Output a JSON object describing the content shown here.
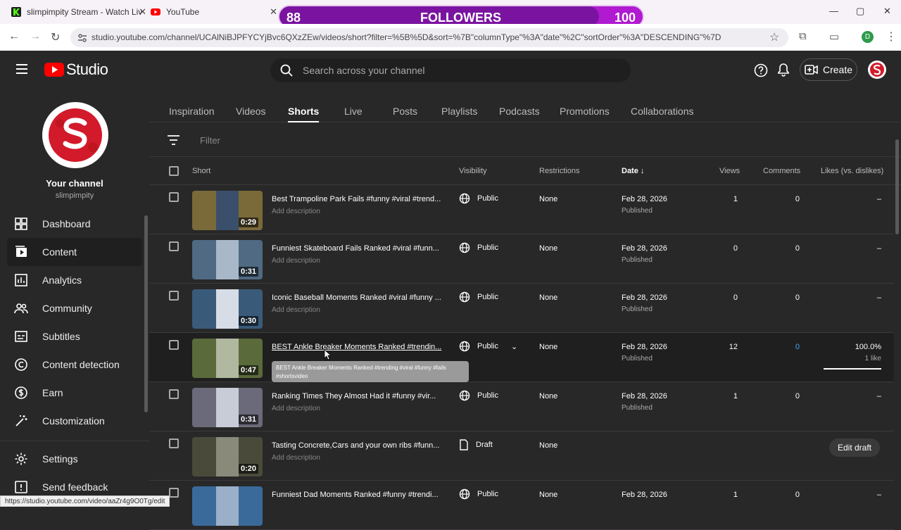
{
  "browser": {
    "tabs": [
      {
        "title": "slimpimpity Stream - Watch Liv"
      },
      {
        "title": "YouTube"
      }
    ],
    "url": "studio.youtube.com/channel/UCAlNiBJPFYCYjBvc6QXzZEw/videos/short?filter=%5B%5D&sort=%7B\"columnType\"%3A\"date\"%2C\"sortOrder\"%3A\"DESCENDING\"%7D",
    "profile_letter": "D",
    "status_url": "https://studio.youtube.com/video/aaZr4g9O0Tg/edit"
  },
  "overlay": {
    "current": "88",
    "label": "FOLLOWERS",
    "goal": "100",
    "progress": 0.88
  },
  "header": {
    "logo": "Studio",
    "search_placeholder": "Search across your channel",
    "create_label": "Create"
  },
  "sidebar": {
    "channel_title": "Your channel",
    "channel_handle": "slimpimpity",
    "items": [
      {
        "label": "Dashboard",
        "icon": "dashboard-icon"
      },
      {
        "label": "Content",
        "icon": "content-icon",
        "active": true
      },
      {
        "label": "Analytics",
        "icon": "analytics-icon"
      },
      {
        "label": "Community",
        "icon": "community-icon"
      },
      {
        "label": "Subtitles",
        "icon": "subtitles-icon"
      },
      {
        "label": "Content detection",
        "icon": "copyright-icon"
      },
      {
        "label": "Earn",
        "icon": "dollar-icon"
      },
      {
        "label": "Customization",
        "icon": "wand-icon"
      },
      {
        "label": "Settings",
        "icon": "gear-icon"
      },
      {
        "label": "Send feedback",
        "icon": "feedback-icon"
      }
    ]
  },
  "content": {
    "tabs": [
      "Inspiration",
      "Videos",
      "Shorts",
      "Live",
      "Posts",
      "Playlists",
      "Podcasts",
      "Promotions",
      "Collaborations"
    ],
    "active_tab": "Shorts",
    "filter_placeholder": "Filter",
    "columns": {
      "short": "Short",
      "visibility": "Visibility",
      "restrictions": "Restrictions",
      "date": "Date",
      "views": "Views",
      "comments": "Comments",
      "likes": "Likes (vs. dislikes)"
    },
    "rows": [
      {
        "title": "Best Trampoline Park Fails #funny #viral #trend...",
        "desc": "Add description",
        "duration": "0:29",
        "visibility": "Public",
        "restrictions": "None",
        "date": "Feb 28, 2026",
        "status": "Published",
        "views": "1",
        "comments": "0",
        "likes": "–"
      },
      {
        "title": "Funniest Skateboard Fails Ranked #viral #funn...",
        "desc": "Add description",
        "duration": "0:31",
        "visibility": "Public",
        "restrictions": "None",
        "date": "Feb 28, 2026",
        "status": "Published",
        "views": "0",
        "comments": "0",
        "likes": "–"
      },
      {
        "title": "Iconic Baseball Moments Ranked #viral #funny ...",
        "desc": "Add description",
        "duration": "0:30",
        "visibility": "Public",
        "restrictions": "None",
        "date": "Feb 28, 2026",
        "status": "Published",
        "views": "0",
        "comments": "0",
        "likes": "–"
      },
      {
        "title": "BEST Ankle Breaker Moments Ranked #trendin...",
        "desc": "",
        "duration": "0:47",
        "visibility": "Public",
        "restrictions": "None",
        "date": "Feb 28, 2026",
        "status": "Published",
        "views": "12",
        "comments": "0",
        "likes": "100.0%",
        "likes_sub": "1 like",
        "tooltip": "BEST Ankle Breaker Moments Ranked #trending #viral #funny #fails #shortsvideo"
      },
      {
        "title": "Ranking Times They Almost Had it #funny #vir...",
        "desc": "Add description",
        "duration": "0:31",
        "visibility": "Public",
        "restrictions": "None",
        "date": "Feb 28, 2026",
        "status": "Published",
        "views": "1",
        "comments": "0",
        "likes": "–"
      },
      {
        "title": "Tasting Concrete,Cars and your own ribs #funn...",
        "desc": "Add description",
        "duration": "0:20",
        "visibility": "Draft",
        "restrictions": "None",
        "date": "",
        "status": "",
        "views": "",
        "comments": "",
        "likes": "",
        "action": "Edit draft"
      },
      {
        "title": "Funniest Dad Moments Ranked #funny #trendi...",
        "desc": "",
        "duration": "",
        "visibility": "Public",
        "restrictions": "None",
        "date": "Feb 28, 2026",
        "status": "",
        "views": "1",
        "comments": "0",
        "likes": "–"
      }
    ]
  }
}
